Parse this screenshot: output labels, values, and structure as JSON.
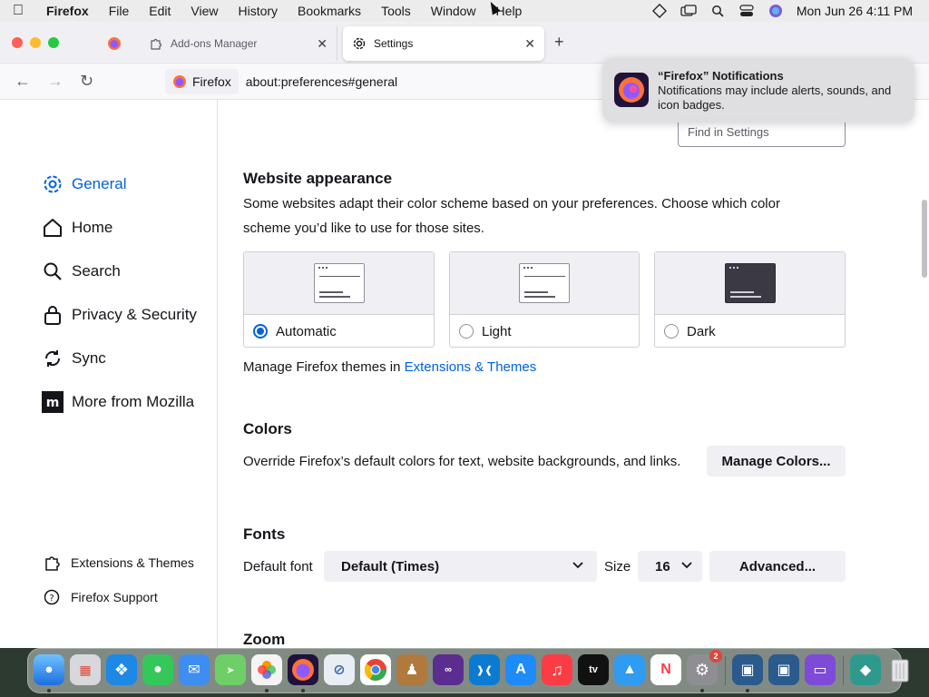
{
  "menubar": {
    "items": [
      "Firefox",
      "File",
      "Edit",
      "View",
      "History",
      "Bookmarks",
      "Tools",
      "Window",
      "Help"
    ],
    "clock": "Mon Jun 26  4:11 PM"
  },
  "tabs": [
    {
      "label": "Add-ons Manager"
    },
    {
      "label": "Settings"
    }
  ],
  "urlbar": {
    "identity_label": "Firefox",
    "url": "about:preferences#general"
  },
  "notification": {
    "title": "“Firefox” Notifications",
    "body": "Notifications may include alerts, sounds, and icon badges."
  },
  "sidebar": {
    "categories": [
      {
        "label": "General",
        "icon": "gear-icon",
        "selected": true
      },
      {
        "label": "Home",
        "icon": "home-icon"
      },
      {
        "label": "Search",
        "icon": "search-icon"
      },
      {
        "label": "Privacy & Security",
        "icon": "lock-icon"
      },
      {
        "label": "Sync",
        "icon": "sync-icon"
      },
      {
        "label": "More from Mozilla",
        "icon": "mozilla-icon"
      }
    ],
    "footer": [
      {
        "label": "Extensions & Themes",
        "icon": "puzzle-icon"
      },
      {
        "label": "Firefox Support",
        "icon": "help-icon"
      }
    ]
  },
  "search": {
    "placeholder": "Find in Settings"
  },
  "website_appearance": {
    "heading": "Website appearance",
    "description": "Some websites adapt their color scheme based on your preferences. Choose which color scheme you’d like to use for those sites.",
    "options": [
      {
        "label": "Automatic",
        "checked": true
      },
      {
        "label": "Light",
        "checked": false
      },
      {
        "label": "Dark",
        "checked": false
      }
    ],
    "manage_prefix": "Manage Firefox themes in ",
    "manage_link": "Extensions & Themes"
  },
  "colors": {
    "heading": "Colors",
    "description": "Override Firefox’s default colors for text, website backgrounds, and links.",
    "button": "Manage Colors..."
  },
  "fonts": {
    "heading": "Fonts",
    "default_font_label": "Default font",
    "default_font_value": "Default (Times)",
    "size_label": "Size",
    "size_value": "16",
    "advanced_button": "Advanced..."
  },
  "zoom": {
    "heading": "Zoom"
  },
  "dock": {
    "badge_count": "2"
  },
  "colors_palette": {
    "accent": "#0061e0",
    "button_bg": "#f0f0f4"
  }
}
